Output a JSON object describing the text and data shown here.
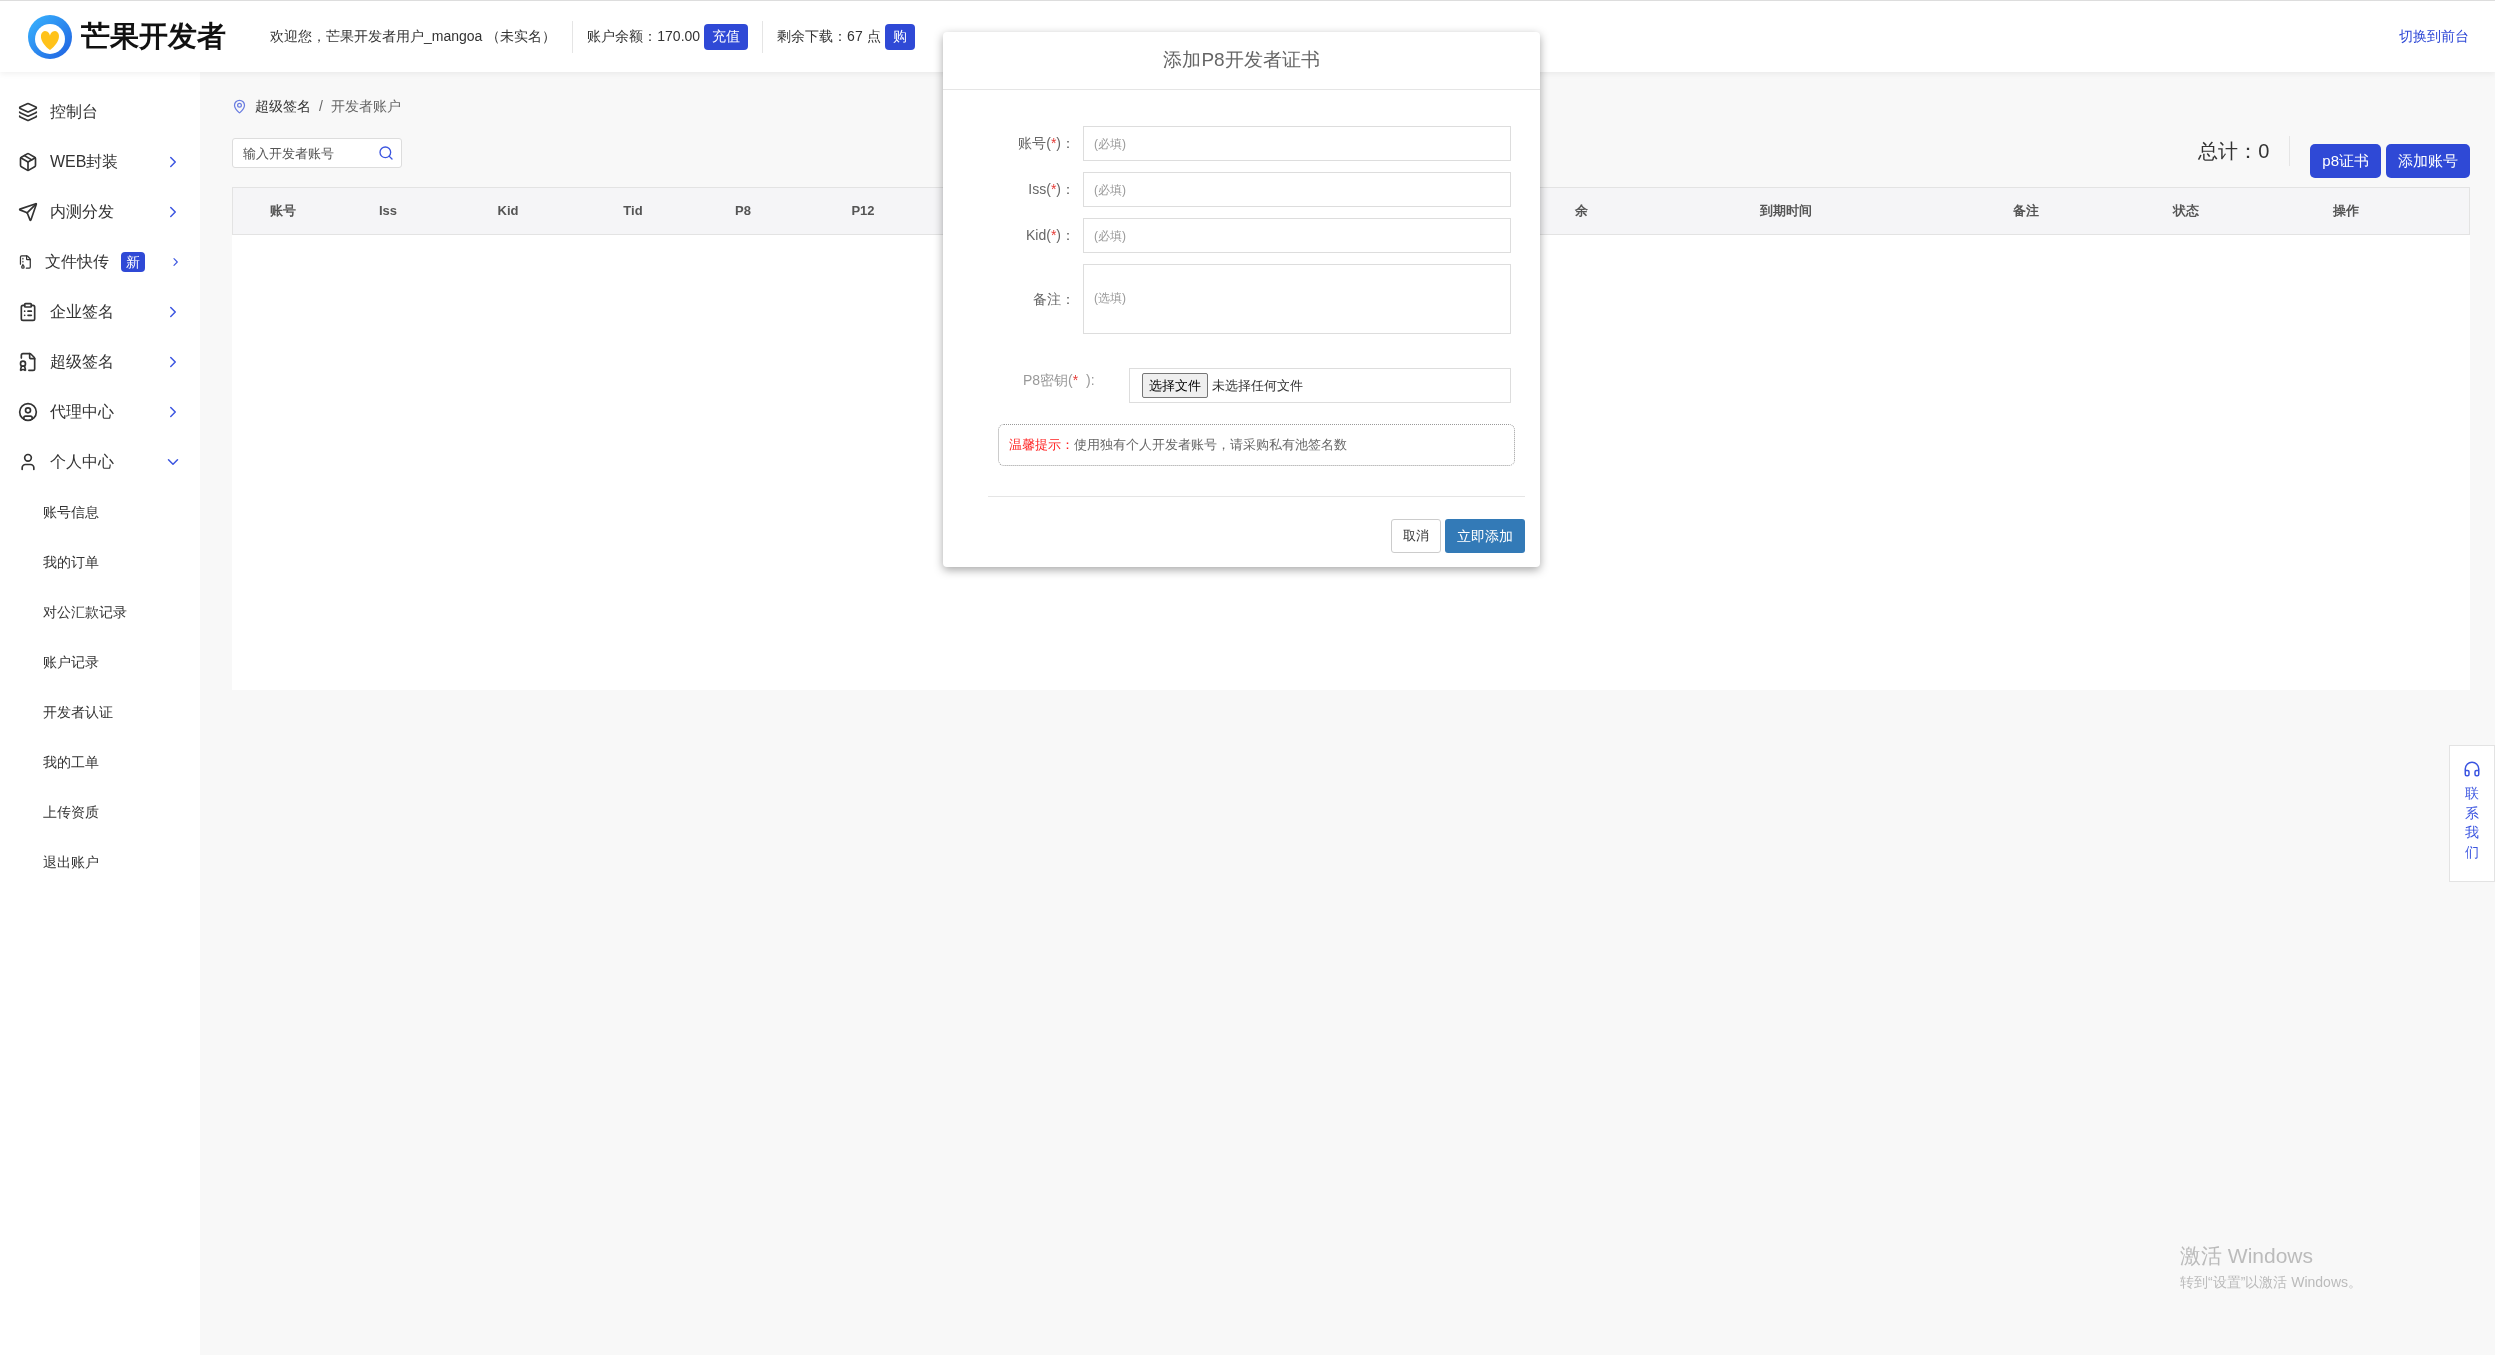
{
  "header": {
    "logo_text": "芒果开发者",
    "welcome": "欢迎您，芒果开发者用户_mangoa （未实名）",
    "balance_label": "账户余额：170.00",
    "recharge_button": "充值",
    "downloads_label": "剩余下载：67 点",
    "buy_button": "购",
    "switch_link": "切换到前台"
  },
  "sidebar": {
    "items": [
      {
        "label": "控制台",
        "kind": "link"
      },
      {
        "label": "WEB封装",
        "kind": "group",
        "expanded": false
      },
      {
        "label": "内测分发",
        "kind": "group",
        "expanded": false
      },
      {
        "label": "文件快传",
        "kind": "group",
        "expanded": false,
        "badge": "新"
      },
      {
        "label": "企业签名",
        "kind": "group",
        "expanded": false
      },
      {
        "label": "超级签名",
        "kind": "group",
        "expanded": false
      },
      {
        "label": "代理中心",
        "kind": "group",
        "expanded": false
      },
      {
        "label": "个人中心",
        "kind": "group",
        "expanded": true,
        "children": [
          "账号信息",
          "我的订单",
          "对公汇款记录",
          "账户记录",
          "开发者认证",
          "我的工单",
          "上传资质",
          "退出账户"
        ]
      }
    ]
  },
  "breadcrumb": {
    "items": [
      "超级签名",
      "开发者账户"
    ],
    "separator": "/"
  },
  "search": {
    "placeholder": "输入开发者账号"
  },
  "total": "总计：0",
  "actions": [
    "p8证书",
    "添加账号"
  ],
  "table": {
    "columns": [
      "账号",
      "Iss",
      "Kid",
      "Tid",
      "P8",
      "P12",
      "余",
      "到期时间",
      "备注",
      "状态",
      "操作"
    ]
  },
  "dialog": {
    "title": "添加P8开发者证书",
    "fields": [
      {
        "label": "账号(",
        "mark": "*",
        "label_end": ")：",
        "placeholder": "(必填)",
        "kind": "input"
      },
      {
        "label": "Iss(",
        "mark": "*",
        "label_end": ")：",
        "placeholder": "(必填)",
        "kind": "input"
      },
      {
        "label": "Kid(",
        "mark": "*",
        "label_end": ")：",
        "placeholder": "(必填)",
        "kind": "input"
      },
      {
        "label": "备注：",
        "placeholder": "(选填)",
        "kind": "textarea"
      }
    ],
    "file_field": {
      "label": "P8密钥(",
      "mark": "*",
      "label_end": "  ):",
      "button": "选择文件",
      "status": "未选择任何文件"
    },
    "tip": {
      "label": "温馨提示：",
      "text": "使用独有个人开发者账号，请采购私有池签名数"
    },
    "cancel": "取消",
    "confirm": "立即添加"
  },
  "contact": "联系我们",
  "os_notice": {
    "title": "激活 Windows",
    "text": "转到“设置”以激活 Windows。"
  }
}
